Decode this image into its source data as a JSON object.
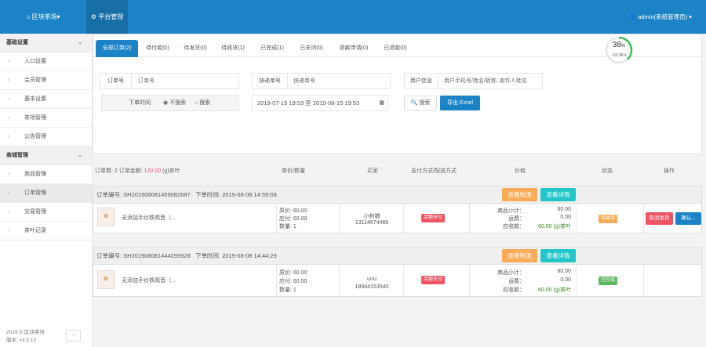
{
  "top": {
    "brand": "区块茶场",
    "nav_item": "平台管理",
    "user": "admin(系统管理员)"
  },
  "sidebar": {
    "groups": [
      {
        "label": "基础设置",
        "items": [
          "入口设置",
          "会员管理",
          "基本设置",
          "茶场管理",
          "公告管理"
        ]
      },
      {
        "label": "商城管理",
        "items": [
          "商品管理",
          "订单管理",
          "交易管理",
          "茶叶记录"
        ]
      }
    ],
    "active_item": "订单管理",
    "footer_line1": "2019 © 区块茶场",
    "footer_line2": "版本: v3.3.13"
  },
  "tabs": [
    "全部订单(2)",
    "待付款(0)",
    "待发货(0)",
    "待收货(1)",
    "已完成(1)",
    "已关闭(0)",
    "退款申请(0)",
    "已退款(0)"
  ],
  "active_tab": "全部订单(2)",
  "filters": {
    "order_no_label": "订单号",
    "order_no_placeholder": "订单号",
    "express_label": "快递单号",
    "express_placeholder": "快递单号",
    "user_label": "用户信息",
    "user_placeholder": "用户手机号/姓名/昵称, 收件人姓名",
    "time_label": "下单时间",
    "radio_no": "不搜索",
    "radio_yes": "搜索",
    "date_range": "2019-07-15 19:53 至 2019-08-15 19:53",
    "search_btn": "搜索",
    "export_btn": "导出 Excel"
  },
  "progress": {
    "percent": 38,
    "speed": "↑33.3K/s"
  },
  "summary": {
    "prefix": "订单数: 2 订单金额: ",
    "amount": "120.00",
    "suffix": " (g)茶叶"
  },
  "columns": [
    "单价/数量",
    "买家",
    "支付方式/配送方式",
    "价格",
    "状态",
    "操作"
  ],
  "orders": [
    {
      "order_no": "订单编号: SH20190808145908268​7",
      "order_time": "下单时间: 2019-08-08 14:59:08",
      "logistics_btn": "查看物流",
      "detail_btn": "查看详情",
      "product": "无添加手炒铁观音（...",
      "unit_price": "原价: 60.00",
      "pay_price": "应付: 60.00",
      "quantity": "数量: 1",
      "buyer_name": "小刺猬",
      "buyer_phone": "13114674466",
      "pay_method": "余额支付",
      "subtotal_label": "商品小计：",
      "subtotal": "60.00",
      "freight_label": "运费：",
      "freight": "0.00",
      "payable_label": "应收款：",
      "payable": "60.00 (g)茶叶",
      "status": "待收货",
      "status_color": "#f8ac59",
      "actions": [
        "取消发货",
        "确认..."
      ]
    },
    {
      "order_no": "订单编号: SH20190808144429592​8",
      "order_time": "下单时间: 2019-08-08 14:44:29",
      "logistics_btn": "查看物流",
      "detail_btn": "查看详情",
      "product": "无添加手炒铁观音（...",
      "unit_price": "原价: 60.00",
      "pay_price": "应付: 60.00",
      "quantity": "数量: 1",
      "buyer_name": "uuu",
      "buyer_phone": "18984153540",
      "pay_method": "余额支付",
      "subtotal_label": "商品小计：",
      "subtotal": "60.00",
      "freight_label": "运费：",
      "freight": "0.00",
      "payable_label": "应收款：",
      "payable": "60.00 (g)茶叶",
      "status": "已完成",
      "status_color": "#5cb85c",
      "actions": []
    }
  ],
  "colors": {
    "primary": "#1c84c6",
    "warning": "#f8ac59",
    "info": "#23c6c8",
    "danger": "#ed5565",
    "success": "#5cb85c"
  }
}
